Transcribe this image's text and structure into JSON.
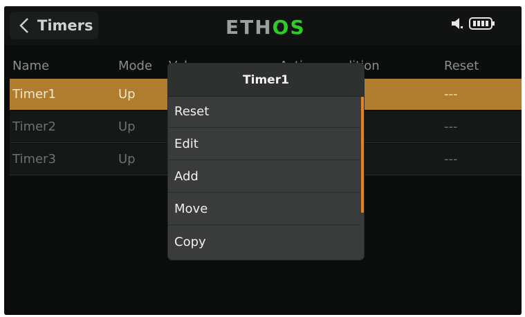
{
  "header": {
    "back_title": "Timers",
    "logo_part1": "ETH",
    "logo_part2": "OS",
    "icons": [
      "back-chevron-icon",
      "speaker-icon",
      "battery-icon"
    ]
  },
  "table": {
    "columns": [
      "Name",
      "Mode",
      "Value",
      "Active condition",
      "Reset"
    ],
    "rows": [
      {
        "name": "Timer1",
        "mode": "Up",
        "reset": "---"
      },
      {
        "name": "Timer2",
        "mode": "Up",
        "reset": "---"
      },
      {
        "name": "Timer3",
        "mode": "Up",
        "reset": "---"
      }
    ]
  },
  "popup": {
    "title": "Timer1",
    "items": [
      "Reset",
      "Edit",
      "Add",
      "Move",
      "Copy"
    ]
  },
  "colors": {
    "selected_row": "#b07d2e",
    "scroll_accent": "#e8801e",
    "logo_green": "#2ecc2a"
  }
}
